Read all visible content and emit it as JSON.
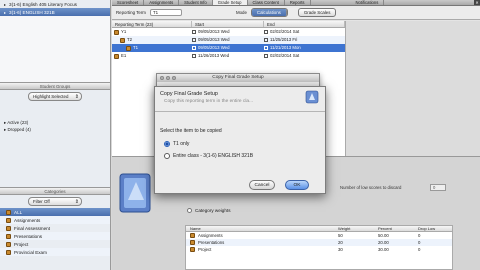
{
  "sidebar": {
    "courses": [
      {
        "label": "3(1-6) English 405 Literary Focus",
        "selected": false
      },
      {
        "label": "3(1-6) ENGLISH 321B",
        "selected": true
      }
    ],
    "student_groups_title": "Student Groups",
    "highlight_popup": "Highlight Selected",
    "statuses": [
      "Active (23)",
      "Dropped (4)"
    ],
    "categories_title": "Categories",
    "filter_popup": "Filter Off",
    "categories": [
      {
        "label": "ALL",
        "selected": true
      },
      {
        "label": "Assignments",
        "selected": false
      },
      {
        "label": "Final Assessment",
        "selected": false
      },
      {
        "label": "Presentations",
        "selected": false
      },
      {
        "label": "Project",
        "selected": false
      },
      {
        "label": "Provincial Exam",
        "selected": false
      }
    ]
  },
  "tabs": [
    {
      "label": "Scoresheet",
      "active": false
    },
    {
      "label": "Assignments",
      "active": false
    },
    {
      "label": "Student Info",
      "active": false
    },
    {
      "label": "Grade Setup",
      "active": true
    },
    {
      "label": "Class Content",
      "active": false
    },
    {
      "label": "Reports",
      "active": false
    },
    {
      "label": "Notifications",
      "active": false
    }
  ],
  "toolbar": {
    "reporting_term_label": "Reporting Term",
    "reporting_term_value": "T1",
    "mode_label": "Mode",
    "mode_options": [
      {
        "label": "Calculations",
        "on": true
      }
    ],
    "grade_scales_label": "Grade Scales"
  },
  "term_table": {
    "headers": {
      "term": "Reporting Term (23)",
      "start": "Start",
      "end": "End"
    },
    "rows": [
      {
        "term": "Y1",
        "start": "09/05/2013 Wed",
        "end": "02/02/2014 Sat",
        "selected": false
      },
      {
        "term": "T2",
        "start": "09/05/2013 Wed",
        "end": "11/25/2013 Fri",
        "selected": false
      },
      {
        "term": "T1",
        "start": "09/05/2013 Wed",
        "end": "11/21/2013 Mon",
        "selected": true
      },
      {
        "term": "E1",
        "start": "11/26/2013 Wed",
        "end": "02/02/2014 Sat",
        "selected": false
      }
    ]
  },
  "grade_setup": {
    "discard_label": "Number of low scores to discard",
    "discard_value": "0",
    "category_weights_label": "Category weights",
    "weights_headers": {
      "name": "Name",
      "weight": "Weight",
      "percent": "Percent",
      "drop_low": "Drop Low"
    },
    "weights_rows": [
      {
        "name": "Assignments",
        "weight": "50",
        "percent": "50.00",
        "drop_low": "0"
      },
      {
        "name": "Presentations",
        "weight": "20",
        "percent": "20.00",
        "drop_low": "0"
      },
      {
        "name": "Project",
        "weight": "30",
        "percent": "30.00",
        "drop_low": "0"
      }
    ]
  },
  "copy_window": {
    "title": "Copy Final Grade Setup"
  },
  "dialog": {
    "title": "Copy Final Grade Setup",
    "subtitle": "Copy this reporting term in the entire cla...",
    "prompt": "Select the item to be copied",
    "options": [
      {
        "label": "T1 only",
        "selected": true
      },
      {
        "label": "Entire class - 3(1-6) ENGLISH 321B",
        "selected": false
      }
    ],
    "cancel_label": "Cancel",
    "ok_label": "OK"
  },
  "colors": {
    "selection": "#3e74d1",
    "accent": "#4a6fae"
  }
}
